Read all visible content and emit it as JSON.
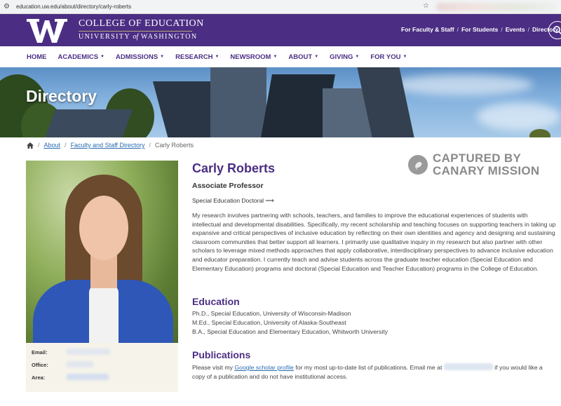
{
  "browser": {
    "url": "education.uw.edu/about/directory/carly-roberts"
  },
  "header": {
    "college": "COLLEGE OF EDUCATION",
    "university_pre": "UNIVERSITY",
    "university_of": "of",
    "university_post": "WASHINGTON",
    "utility_links": [
      "For Faculty & Staff",
      "For Students",
      "Events",
      "Directory"
    ]
  },
  "nav": {
    "items": [
      "HOME",
      "ACADEMICS",
      "ADMISSIONS",
      "RESEARCH",
      "NEWSROOM",
      "ABOUT",
      "GIVING",
      "FOR YOU"
    ]
  },
  "hero": {
    "title": "Directory"
  },
  "breadcrumb": {
    "items": [
      "About",
      "Faculty and Staff Directory"
    ],
    "current": "Carly Roberts"
  },
  "profile": {
    "name": "Carly Roberts",
    "title": "Associate Professor",
    "program": "Special Education Doctoral",
    "bio": "My research involves partnering with schools, teachers, and families to improve the educational experiences of students with intellectual and developmental disabilities. Specifically, my recent scholarship and teaching focuses on supporting teachers in taking up expansive and critical perspectives of inclusive education by reflecting on their own identities and agency and designing and sustaining classroom communities that better support all learners. I primarily use qualitative inquiry in my research but also partner with other scholars to leverage mixed methods approaches that apply collaborative, interdisciplinary perspectives to advance inclusive education and educator preparation. I currently teach and advise students across the graduate teacher education (Special Education and Elementary Education) programs and doctoral (Special Education and Teacher Education) programs in the College of Education."
  },
  "contact": {
    "email_label": "Email:",
    "office_label": "Office:",
    "area_label": "Area:"
  },
  "education": {
    "heading": "Education",
    "degrees": [
      "Ph.D., Special Education, University of Wisconsin-Madison",
      "M.Ed., Special Education, University of Alaska-Southeast",
      "B.A., Special Education and Elementary Education, Whitworth University"
    ]
  },
  "publications": {
    "heading": "Publications",
    "text_before": "Please visit my ",
    "link": "Google scholar profile",
    "text_middle": " for my most up-to-date list of publications. Email me at ",
    "text_after": " if you would like a copy of a publication and do not have institutional access."
  },
  "watermark": {
    "line1": "CAPTURED BY",
    "line2": "CANARY MISSION"
  },
  "colors": {
    "uw_purple": "#4b2e83",
    "link_blue": "#2a6cb0",
    "gold": "#b7a57a"
  }
}
